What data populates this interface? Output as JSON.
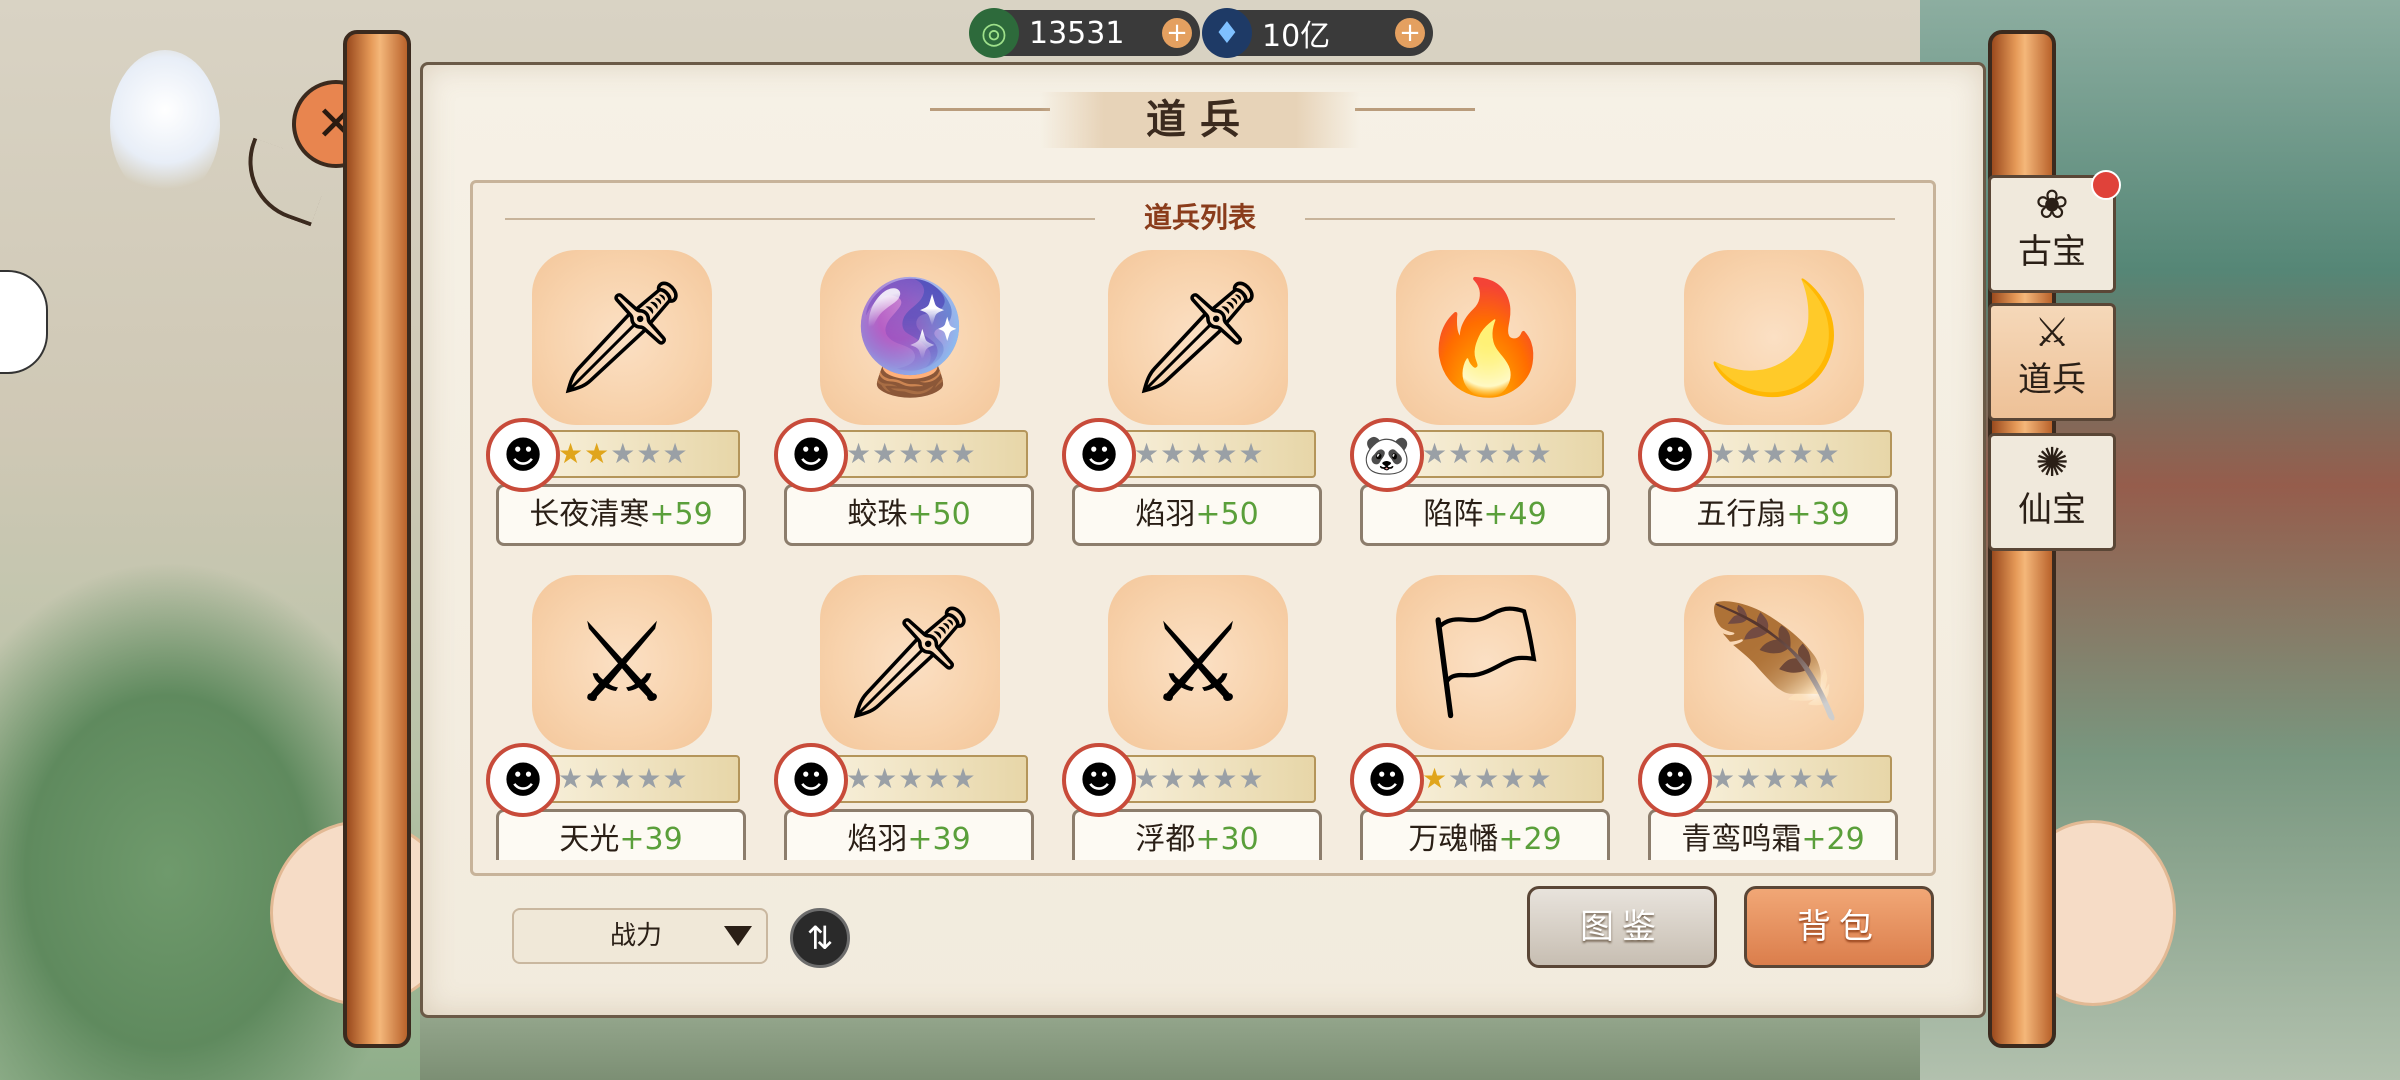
{
  "currency": [
    {
      "icon": "jade-coin-icon",
      "glyph": "◎",
      "value": "13531"
    },
    {
      "icon": "spirit-crystal-icon",
      "glyph": "♦",
      "value": "10亿"
    }
  ],
  "close_glyph": "✕",
  "title": "道兵",
  "list_title": "道兵列表",
  "weapons": [
    {
      "name": "长夜清寒",
      "level": "+59",
      "stars": 2,
      "art": "🗡",
      "avatar": "☻"
    },
    {
      "name": "蛟珠",
      "level": "+50",
      "stars": 0,
      "art": "🔮",
      "avatar": "☻"
    },
    {
      "name": "焰羽",
      "level": "+50",
      "stars": 0,
      "art": "🗡",
      "avatar": "☻"
    },
    {
      "name": "陷阵",
      "level": "+49",
      "stars": 0,
      "art": "🔥",
      "avatar": "🐼"
    },
    {
      "name": "五行扇",
      "level": "+39",
      "stars": 0,
      "art": "🌙",
      "avatar": "☻"
    },
    {
      "name": "天光",
      "level": "+39",
      "stars": 0,
      "art": "⚔",
      "avatar": "☻"
    },
    {
      "name": "焰羽",
      "level": "+39",
      "stars": 0,
      "art": "🗡",
      "avatar": "☻"
    },
    {
      "name": "浮都",
      "level": "+30",
      "stars": 0,
      "art": "⚔",
      "avatar": "☻"
    },
    {
      "name": "万魂幡",
      "level": "+29",
      "stars": 1,
      "art": "🏳",
      "avatar": "☻"
    },
    {
      "name": "青鸾鸣霜",
      "level": "+29",
      "stars": 0,
      "art": "🪶",
      "avatar": "☻"
    }
  ],
  "sort": {
    "label": "战力",
    "swap_glyph": "⇅"
  },
  "buttons": {
    "codex": "图鉴",
    "bag": "背包"
  },
  "side_tabs": [
    {
      "label": "古宝",
      "icon": "❀",
      "badge": true,
      "active": false
    },
    {
      "label": "道兵",
      "icon": "⚔",
      "badge": false,
      "active": true
    },
    {
      "label": "仙宝",
      "icon": "✺",
      "badge": false,
      "active": false
    }
  ]
}
